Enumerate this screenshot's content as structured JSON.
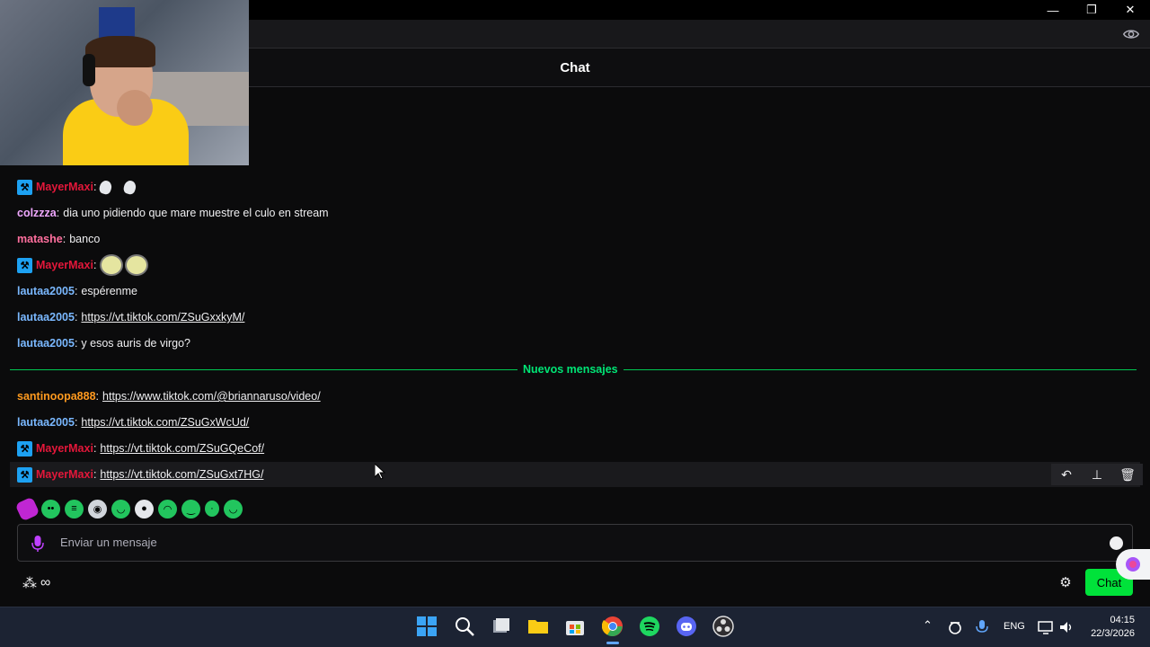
{
  "window": {
    "minimize": "—",
    "restore": "❐",
    "close": "✕"
  },
  "chat": {
    "title": "Chat",
    "new_messages_label": "Nuevos mensajes",
    "input_placeholder": "Enviar un mensaje",
    "chat_button": "Chat"
  },
  "colors": {
    "accent_green": "#00e23a",
    "mod_user": "#e3173a",
    "badge_blue": "#1da1f2"
  },
  "messages": [
    {
      "user": "MayerMaxi",
      "color": "#e3173a",
      "badge": true,
      "type": "emotes-small",
      "text": ""
    },
    {
      "user": "colzzza",
      "color": "#f0a8ff",
      "badge": false,
      "type": "text",
      "text": "dia uno pidiendo que mare muestre el culo en stream"
    },
    {
      "user": "matashe",
      "color": "#ff6f9e",
      "badge": false,
      "type": "text",
      "text": "banco"
    },
    {
      "user": "MayerMaxi",
      "color": "#e3173a",
      "badge": true,
      "type": "emotes-face",
      "text": ""
    },
    {
      "user": "lautaa2005",
      "color": "#7ab8ff",
      "badge": false,
      "type": "text",
      "text": "espérenme"
    },
    {
      "user": "lautaa2005",
      "color": "#7ab8ff",
      "badge": false,
      "type": "link",
      "text": "https://vt.tiktok.com/ZSuGxxkyM/"
    },
    {
      "user": "lautaa2005",
      "color": "#7ab8ff",
      "badge": false,
      "type": "text",
      "text": "y esos auris de virgo?"
    },
    {
      "user": "santinoopa888",
      "color": "#ff9a1f",
      "badge": false,
      "type": "link",
      "text": "https://www.tiktok.com/@briannaruso/video/"
    },
    {
      "user": "lautaa2005",
      "color": "#7ab8ff",
      "badge": false,
      "type": "link",
      "text": "https://vt.tiktok.com/ZSuGxWcUd/"
    },
    {
      "user": "MayerMaxi",
      "color": "#e3173a",
      "badge": true,
      "type": "link",
      "text": "https://vt.tiktok.com/ZSuGQeCof/"
    },
    {
      "user": "MayerMaxi",
      "color": "#e3173a",
      "badge": true,
      "type": "link",
      "text": "https://vt.tiktok.com/ZSuGxt7HG/"
    }
  ],
  "emote_bar": [
    "pink-pill",
    "ghost",
    "face",
    "skull",
    "blob",
    "ghost-eyes",
    "smile",
    "blob",
    "small",
    "blob"
  ],
  "row_actions": [
    "reply-icon",
    "pin-icon",
    "delete-icon"
  ],
  "taskbar": {
    "apps": [
      "windows-start",
      "search",
      "task-view",
      "file-explorer",
      "store",
      "chrome",
      "spotify",
      "discord",
      "obs"
    ],
    "language": "ENG",
    "time": "04:15",
    "date": "22/3/2026"
  }
}
